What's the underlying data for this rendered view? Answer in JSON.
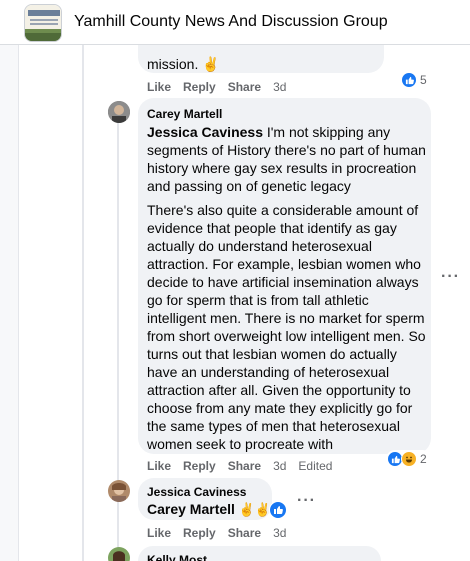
{
  "header": {
    "group_title": "Yamhill County News And Discussion Group"
  },
  "comment_top": {
    "text": "mission. ✌",
    "actions": {
      "like": "Like",
      "reply": "Reply",
      "share": "Share",
      "time": "3d"
    },
    "reaction_count": "5"
  },
  "comment_carey": {
    "author": "Carey Martell",
    "tag": "Jessica Caviness",
    "paragraph1": " I'm not skipping any segments of History there's no part of human history where gay sex results in procreation and passing on of genetic legacy",
    "paragraph2": "There's also quite a considerable amount of evidence that people that identify as gay actually do understand heterosexual attraction. For example, lesbian women who decide to have artificial insemination always go for sperm that is from tall athletic intelligent men. There is no market for sperm from short overweight low intelligent men. So turns out that lesbian women do actually have an understanding of heterosexual attraction after all. Given the opportunity to choose from any mate they explicitly go for the same types of men that heterosexual women seek to procreate with",
    "actions": {
      "like": "Like",
      "reply": "Reply",
      "share": "Share",
      "time": "3d",
      "edited": "Edited"
    },
    "reaction_count": "2"
  },
  "comment_jessica": {
    "author": "Jessica Caviness",
    "tag": "Carey Martell",
    "emoji": " ✌✌",
    "actions": {
      "like": "Like",
      "reply": "Reply",
      "share": "Share",
      "time": "3d"
    }
  },
  "comment_kelly": {
    "author": "Kelly Most"
  },
  "colors": {
    "accent": "#1877f2",
    "bubble": "#f0f2f5",
    "meta": "#65676b"
  },
  "icons": [
    "group-thumbnail",
    "like-icon",
    "haha-icon",
    "more-options-icon"
  ]
}
